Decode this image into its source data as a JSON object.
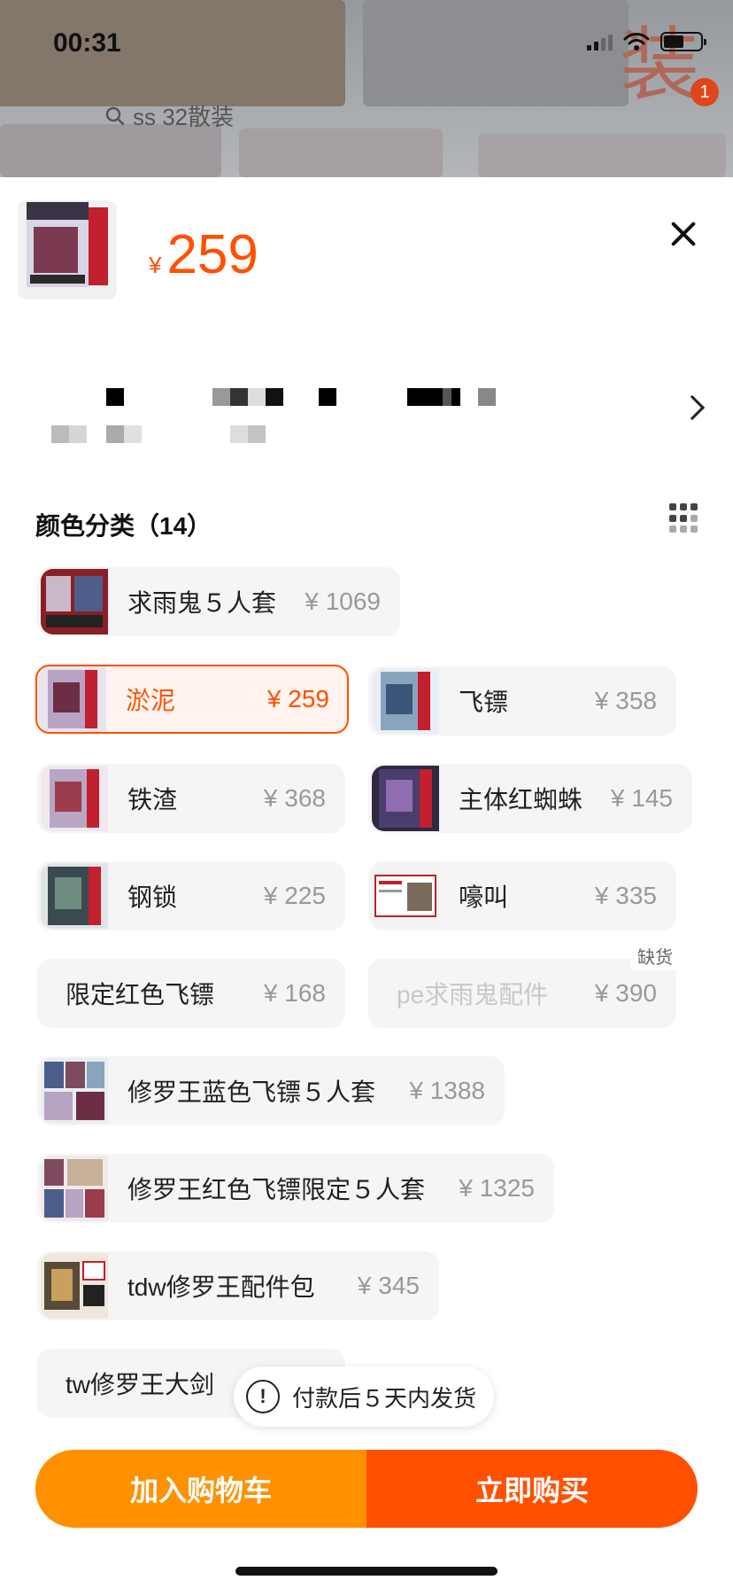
{
  "status_bar": {
    "time": "00:31"
  },
  "background": {
    "search_text": "ss 32散装",
    "badge_count": "1"
  },
  "product": {
    "currency": "¥",
    "price": "259"
  },
  "variants": {
    "section_title": "颜色分类（14）",
    "out_of_stock_label": "缺货",
    "options": [
      {
        "name": "求雨鬼５人套",
        "price": "¥ 1069",
        "selected": false,
        "disabled": false
      },
      {
        "name": "淤泥",
        "price": "¥ 259",
        "selected": true,
        "disabled": false
      },
      {
        "name": "飞镖",
        "price": "¥ 358",
        "selected": false,
        "disabled": false
      },
      {
        "name": "铁渣",
        "price": "¥ 368",
        "selected": false,
        "disabled": false
      },
      {
        "name": "主体红蜘蛛",
        "price": "¥ 145",
        "selected": false,
        "disabled": false
      },
      {
        "name": "钢锁",
        "price": "¥ 225",
        "selected": false,
        "disabled": false
      },
      {
        "name": "嚎叫",
        "price": "¥ 335",
        "selected": false,
        "disabled": false
      },
      {
        "name": "限定红色飞镖",
        "price": "¥ 168",
        "selected": false,
        "disabled": false
      },
      {
        "name": "pe求雨鬼配件",
        "price": "¥ 390",
        "selected": false,
        "disabled": true
      },
      {
        "name": "修罗王蓝色飞镖５人套",
        "price": "¥ 1388",
        "selected": false,
        "disabled": false
      },
      {
        "name": "修罗王红色飞镖限定５人套",
        "price": "¥ 1325",
        "selected": false,
        "disabled": false
      },
      {
        "name": "tdw修罗王配件包",
        "price": "¥ 345",
        "selected": false,
        "disabled": false
      },
      {
        "name": "tw修罗王大剑",
        "price": "",
        "selected": false,
        "disabled": false
      }
    ]
  },
  "shipping_tip": "付款后５天内发货",
  "buttons": {
    "add_to_cart": "加入购物车",
    "buy_now": "立即购买"
  },
  "colors": {
    "accent": "#ff5000",
    "cart_button": "#ff9000",
    "buy_button": "#ff5000"
  }
}
